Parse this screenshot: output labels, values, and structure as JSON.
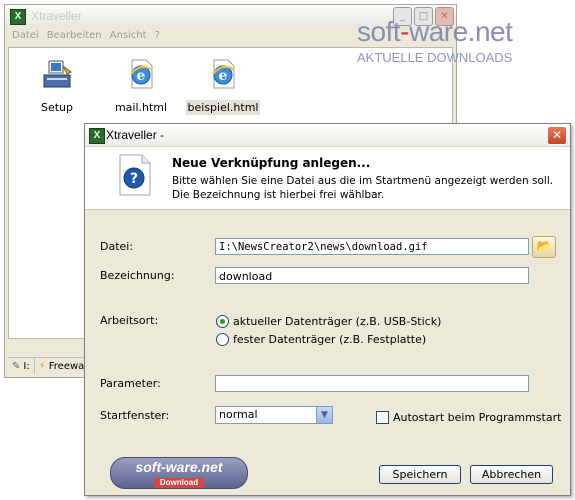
{
  "background_window": {
    "title": "Xtraveller",
    "menu": [
      "Datei",
      "Bearbeiten",
      "Ansicht",
      "?"
    ],
    "icons": [
      {
        "label": "Setup",
        "icon": "setup-icon",
        "selected": false
      },
      {
        "label": "mail.html",
        "icon": "html-file-icon",
        "selected": false
      },
      {
        "label": "beispiel.html",
        "icon": "html-file-icon",
        "selected": true
      }
    ],
    "status": [
      "I:",
      "Freewa"
    ]
  },
  "watermark": {
    "brand_part1": "soft",
    "brand_part2": "ware",
    "brand_part3": ".net",
    "tagline": "AKTUELLE DOWNLOADS"
  },
  "dialog": {
    "title": "Xtraveller -",
    "heading": "Neue Verknüpfung anlegen...",
    "description": "Bitte wählen Sie eine Datei aus die im Startmenü angezeigt werden soll. Die Bezeichnung ist hierbei frei wählbar.",
    "fields": {
      "file_label": "Datei:",
      "file_value": "I:\\NewsCreator2\\news\\download.gif",
      "name_label": "Bezeichnung:",
      "name_value": "download",
      "workdir_label": "Arbeitsort:",
      "workdir_options": [
        "aktueller Datenträger (z.B. USB-Stick)",
        "fester Datenträger (z.B. Festplatte)"
      ],
      "workdir_selected": 0,
      "param_label": "Parameter:",
      "param_value": "",
      "startwin_label": "Startfenster:",
      "startwin_value": "normal",
      "autostart_label": "Autostart beim Programmstart",
      "autostart_checked": false
    },
    "buttons": {
      "save": "Speichern",
      "cancel": "Abbrechen"
    },
    "badge": {
      "main": "soft-ware.net",
      "sub": "Download"
    }
  },
  "colors": {
    "accent_brand": "#8590b6",
    "brand_red": "#d23c3c",
    "dialog_bg": "#ece9d8",
    "close_red": "#c54521"
  }
}
